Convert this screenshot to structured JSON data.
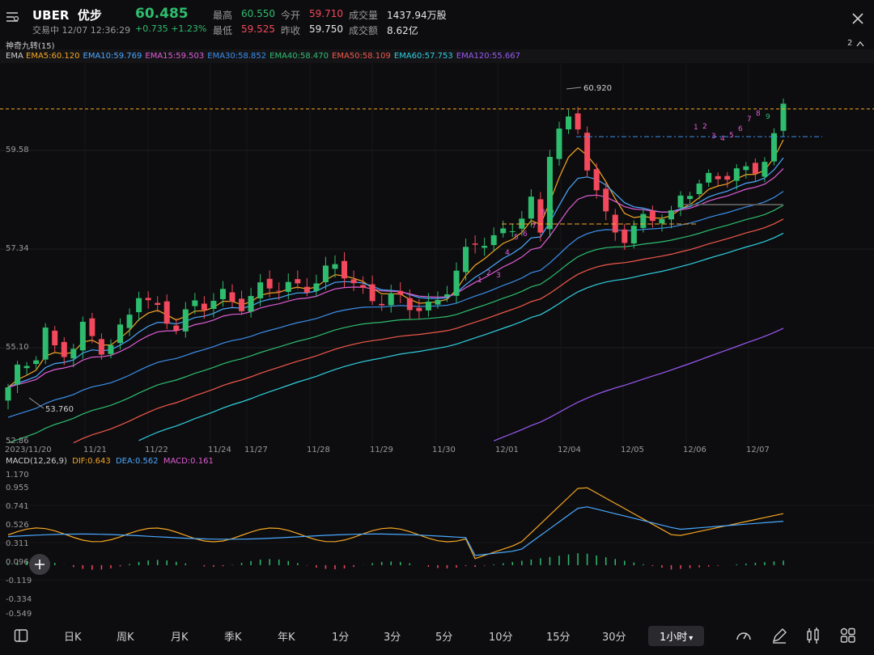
{
  "header": {
    "symbol": "UBER",
    "name": "优步",
    "price": "60.485",
    "status": "交易中 12/07 12:36:29",
    "change": "+0.735",
    "change_pct": "+1.23%",
    "high_label": "最高",
    "high": "60.550",
    "low_label": "最低",
    "low": "59.525",
    "open_label": "今开",
    "open": "59.710",
    "prev_label": "昨收",
    "prev": "59.750",
    "vol_label": "成交量",
    "vol": "1437.94万股",
    "amt_label": "成交额",
    "amt": "8.62亿"
  },
  "indicator_bar": {
    "title": "神奇九转(15)",
    "count": "2"
  },
  "ema": {
    "label": "EMA",
    "items": [
      {
        "text": "EMA5:60.120",
        "color": "#f5a623"
      },
      {
        "text": "EMA10:59.769",
        "color": "#4aa8ff"
      },
      {
        "text": "EMA15:59.503",
        "color": "#e05cd6"
      },
      {
        "text": "EMA30:58.852",
        "color": "#3b8eea"
      },
      {
        "text": "EMA40:58.470",
        "color": "#2ebd6e"
      },
      {
        "text": "EMA50:58.109",
        "color": "#f2584a"
      },
      {
        "text": "EMA60:57.753",
        "color": "#2fd0e0"
      },
      {
        "text": "EMA120:55.667",
        "color": "#9b59f5"
      }
    ]
  },
  "price_axis": [
    "59.58",
    "57.34",
    "55.10",
    "52.86"
  ],
  "annotations": {
    "max": "60.920",
    "min": "53.760"
  },
  "dates": [
    "2023/11/20",
    "11/21",
    "11/22",
    "11/24",
    "11/27",
    "11/28",
    "11/29",
    "11/30",
    "12/01",
    "12/04",
    "12/05",
    "12/06",
    "12/07"
  ],
  "macd": {
    "label": "MACD(12,26,9)",
    "dif": "DIF:0.643",
    "dea": "DEA:0.562",
    "macd": "MACD:0.161",
    "axis": [
      "1.170",
      "0.955",
      "0.741",
      "0.526",
      "0.311",
      "0.096",
      "-0.119",
      "-0.334",
      "-0.549"
    ]
  },
  "toolbar": {
    "items": [
      "日K",
      "周K",
      "月K",
      "季K",
      "年K",
      "1分",
      "3分",
      "5分",
      "10分",
      "15分",
      "30分"
    ],
    "active": "1小时",
    "active_arrow": "▾"
  },
  "td_seq": [
    "1",
    "2",
    "3",
    "4",
    "5",
    "6",
    "7",
    "8",
    "9",
    "1",
    "2",
    "3",
    "4",
    "5",
    "6",
    "7",
    "8",
    "9"
  ],
  "chart_data": {
    "type": "line",
    "title": "UBER 1小时",
    "candles_note": "hourly candles, approx",
    "ema_colors": {
      "EMA5": "#f5a623",
      "EMA10": "#4aa8ff",
      "EMA15": "#e05cd6",
      "EMA30": "#3b8eea",
      "EMA40": "#2ebd6e",
      "EMA50": "#f2584a",
      "EMA60": "#2fd0e0",
      "EMA120": "#9b59f5"
    }
  }
}
